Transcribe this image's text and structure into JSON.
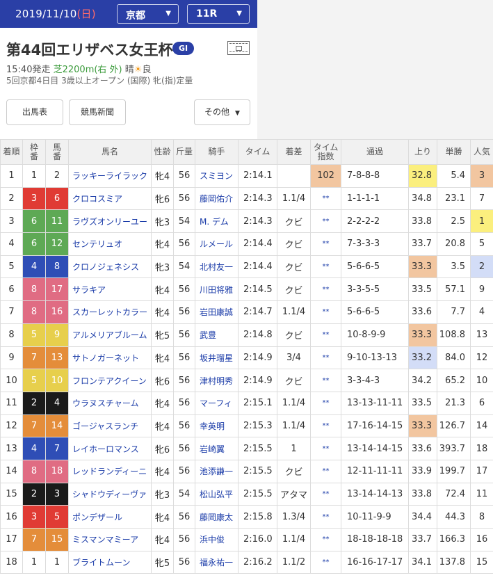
{
  "header": {
    "date": "2019/11/10",
    "day_of_week": "(日)",
    "venue": "京都",
    "race_number": "11R"
  },
  "race": {
    "title": "第44回エリザベス女王杯",
    "grade": "GI",
    "start_time": "15:40発走",
    "course": "芝2200m(右 外)",
    "weather": "晴",
    "condition": "良",
    "meeting_info": "5回京都4日目 3歳以上オープン (国際) 牝(指)定量"
  },
  "buttons": {
    "entry": "出馬表",
    "newspaper": "競馬新聞",
    "other": "その他"
  },
  "icons": {
    "weather": "sun-icon",
    "movie": "film-icon",
    "dropdown": "chevron-down-icon"
  },
  "colors": {
    "header_bg": "#2a3fa6",
    "link": "#1a3ba8",
    "highlight_orange": "#f2c6a0",
    "highlight_yellow": "#fbef7e",
    "highlight_blue": "#d3ddf7",
    "frame": {
      "1": "#ffffff",
      "2": "#1a1a1a",
      "3": "#e03b34",
      "4": "#2f4eb6",
      "5": "#e7cf4c",
      "6": "#5ea955",
      "7": "#e48d3a",
      "8": "#e06c83"
    }
  },
  "table": {
    "headers": [
      "着順",
      "枠番",
      "馬番",
      "馬名",
      "性齢",
      "斤量",
      "騎手",
      "タイム",
      "着差",
      "タイム指数",
      "通過",
      "上り",
      "単勝",
      "人気"
    ],
    "rows": [
      {
        "pos": "1",
        "frame": "1",
        "num": "2",
        "name": "ラッキーライラック",
        "sex_age": "牝4",
        "weight": "56",
        "jockey": "スミヨン",
        "time": "2:14.1",
        "margin": "",
        "index": "102",
        "corner": "7-8-8-8",
        "agari": "32.8",
        "odds": "5.4",
        "pop": "3"
      },
      {
        "pos": "2",
        "frame": "3",
        "num": "6",
        "name": "クロコスミア",
        "sex_age": "牝6",
        "weight": "56",
        "jockey": "藤岡佑介",
        "time": "2:14.3",
        "margin": "1.1/4",
        "index": "**",
        "corner": "1-1-1-1",
        "agari": "34.8",
        "odds": "23.1",
        "pop": "7"
      },
      {
        "pos": "3",
        "frame": "6",
        "num": "11",
        "name": "ラヴズオンリーユー",
        "sex_age": "牝3",
        "weight": "54",
        "jockey": "M. デム",
        "time": "2:14.3",
        "margin": "クビ",
        "index": "**",
        "corner": "2-2-2-2",
        "agari": "33.8",
        "odds": "2.5",
        "pop": "1"
      },
      {
        "pos": "4",
        "frame": "6",
        "num": "12",
        "name": "センテリュオ",
        "sex_age": "牝4",
        "weight": "56",
        "jockey": "ルメール",
        "time": "2:14.4",
        "margin": "クビ",
        "index": "**",
        "corner": "7-3-3-3",
        "agari": "33.7",
        "odds": "20.8",
        "pop": "5"
      },
      {
        "pos": "5",
        "frame": "4",
        "num": "8",
        "name": "クロノジェネシス",
        "sex_age": "牝3",
        "weight": "54",
        "jockey": "北村友一",
        "time": "2:14.4",
        "margin": "クビ",
        "index": "**",
        "corner": "5-6-6-5",
        "agari": "33.3",
        "odds": "3.5",
        "pop": "2"
      },
      {
        "pos": "6",
        "frame": "8",
        "num": "17",
        "name": "サラキア",
        "sex_age": "牝4",
        "weight": "56",
        "jockey": "川田将雅",
        "time": "2:14.5",
        "margin": "クビ",
        "index": "**",
        "corner": "3-3-5-5",
        "agari": "33.5",
        "odds": "57.1",
        "pop": "9"
      },
      {
        "pos": "7",
        "frame": "8",
        "num": "16",
        "name": "スカーレットカラー",
        "sex_age": "牝4",
        "weight": "56",
        "jockey": "岩田康誠",
        "time": "2:14.7",
        "margin": "1.1/4",
        "index": "**",
        "corner": "5-6-6-5",
        "agari": "33.6",
        "odds": "7.7",
        "pop": "4"
      },
      {
        "pos": "8",
        "frame": "5",
        "num": "9",
        "name": "アルメリアブルーム",
        "sex_age": "牝5",
        "weight": "56",
        "jockey": "武豊",
        "time": "2:14.8",
        "margin": "クビ",
        "index": "**",
        "corner": "10-8-9-9",
        "agari": "33.3",
        "odds": "108.8",
        "pop": "13"
      },
      {
        "pos": "9",
        "frame": "7",
        "num": "13",
        "name": "サトノガーネット",
        "sex_age": "牝4",
        "weight": "56",
        "jockey": "坂井瑠星",
        "time": "2:14.9",
        "margin": "3/4",
        "index": "**",
        "corner": "9-10-13-13",
        "agari": "33.2",
        "odds": "84.0",
        "pop": "12"
      },
      {
        "pos": "10",
        "frame": "5",
        "num": "10",
        "name": "フロンテアクイーン",
        "sex_age": "牝6",
        "weight": "56",
        "jockey": "津村明秀",
        "time": "2:14.9",
        "margin": "クビ",
        "index": "**",
        "corner": "3-3-4-3",
        "agari": "34.2",
        "odds": "65.2",
        "pop": "10"
      },
      {
        "pos": "11",
        "frame": "2",
        "num": "4",
        "name": "ウラヌスチャーム",
        "sex_age": "牝4",
        "weight": "56",
        "jockey": "マーフィ",
        "time": "2:15.1",
        "margin": "1.1/4",
        "index": "**",
        "corner": "13-13-11-11",
        "agari": "33.5",
        "odds": "21.3",
        "pop": "6"
      },
      {
        "pos": "12",
        "frame": "7",
        "num": "14",
        "name": "ゴージャスランチ",
        "sex_age": "牝4",
        "weight": "56",
        "jockey": "幸英明",
        "time": "2:15.3",
        "margin": "1.1/4",
        "index": "**",
        "corner": "17-16-14-15",
        "agari": "33.3",
        "odds": "126.7",
        "pop": "14"
      },
      {
        "pos": "13",
        "frame": "4",
        "num": "7",
        "name": "レイホーロマンス",
        "sex_age": "牝6",
        "weight": "56",
        "jockey": "岩崎翼",
        "time": "2:15.5",
        "margin": "1",
        "index": "**",
        "corner": "13-14-14-15",
        "agari": "33.6",
        "odds": "393.7",
        "pop": "18"
      },
      {
        "pos": "14",
        "frame": "8",
        "num": "18",
        "name": "レッドランディーニ",
        "sex_age": "牝4",
        "weight": "56",
        "jockey": "池添謙一",
        "time": "2:15.5",
        "margin": "クビ",
        "index": "**",
        "corner": "12-11-11-11",
        "agari": "33.9",
        "odds": "199.7",
        "pop": "17"
      },
      {
        "pos": "15",
        "frame": "2",
        "num": "3",
        "name": "シャドウディーヴァ",
        "sex_age": "牝3",
        "weight": "54",
        "jockey": "松山弘平",
        "time": "2:15.5",
        "margin": "アタマ",
        "index": "**",
        "corner": "13-14-14-13",
        "agari": "33.8",
        "odds": "72.4",
        "pop": "11"
      },
      {
        "pos": "16",
        "frame": "3",
        "num": "5",
        "name": "ポンデザール",
        "sex_age": "牝4",
        "weight": "56",
        "jockey": "藤岡康太",
        "time": "2:15.8",
        "margin": "1.3/4",
        "index": "**",
        "corner": "10-11-9-9",
        "agari": "34.4",
        "odds": "44.3",
        "pop": "8"
      },
      {
        "pos": "17",
        "frame": "7",
        "num": "15",
        "name": "ミスマンマミーア",
        "sex_age": "牝4",
        "weight": "56",
        "jockey": "浜中俊",
        "time": "2:16.0",
        "margin": "1.1/4",
        "index": "**",
        "corner": "18-18-18-18",
        "agari": "33.7",
        "odds": "166.3",
        "pop": "16"
      },
      {
        "pos": "18",
        "frame": "1",
        "num": "1",
        "name": "ブライトムーン",
        "sex_age": "牝5",
        "weight": "56",
        "jockey": "福永祐一",
        "time": "2:16.2",
        "margin": "1.1/2",
        "index": "**",
        "corner": "16-16-17-17",
        "agari": "34.1",
        "odds": "137.8",
        "pop": "15"
      }
    ],
    "highlights": {
      "index": {
        "0": "orange"
      },
      "agari": {
        "0": "yellow",
        "4": "orange",
        "7": "orange",
        "8": "blue",
        "11": "orange"
      },
      "pop": {
        "0": "orange",
        "2": "yellow",
        "4": "blue"
      }
    }
  }
}
